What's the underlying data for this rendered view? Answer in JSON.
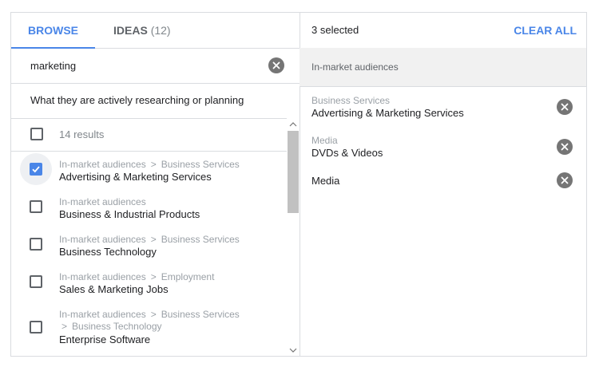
{
  "tabs": {
    "browse": "BROWSE",
    "ideas": "IDEAS",
    "ideas_count": "(12)"
  },
  "search": {
    "value": "marketing"
  },
  "filter": {
    "label": "What they are actively researching or planning"
  },
  "results": {
    "count_label": "14 results",
    "separator": ">",
    "items": [
      {
        "crumb1": "In-market audiences",
        "crumb2": "Business Services",
        "crumb3": "",
        "name": "Advertising & Marketing Services",
        "checked": true
      },
      {
        "crumb1": "In-market audiences",
        "crumb2": "",
        "crumb3": "",
        "name": "Business & Industrial Products",
        "checked": false
      },
      {
        "crumb1": "In-market audiences",
        "crumb2": "Business Services",
        "crumb3": "",
        "name": "Business Technology",
        "checked": false
      },
      {
        "crumb1": "In-market audiences",
        "crumb2": "Employment",
        "crumb3": "",
        "name": "Sales & Marketing Jobs",
        "checked": false
      },
      {
        "crumb1": "In-market audiences",
        "crumb2": "Business Services",
        "crumb3": "Business Technology",
        "name": "Enterprise Software",
        "checked": false
      }
    ]
  },
  "selection": {
    "count_label": "3 selected",
    "clear_all": "CLEAR ALL",
    "group_label": "In-market audiences",
    "items": [
      {
        "crumb": "Business Services",
        "name": "Advertising & Marketing Services"
      },
      {
        "crumb": "Media",
        "name": "DVDs & Videos"
      },
      {
        "crumb": "",
        "name": "Media"
      }
    ]
  },
  "colors": {
    "accent": "#4a86e8",
    "remove_icon": "#757575",
    "muted_text": "#9aa0a6"
  },
  "icons": {
    "search_clear": "close-circle-icon",
    "remove": "close-circle-icon",
    "checkbox_checked": "check-icon",
    "scroll_up": "chevron-up-icon",
    "scroll_down": "chevron-down-icon"
  }
}
